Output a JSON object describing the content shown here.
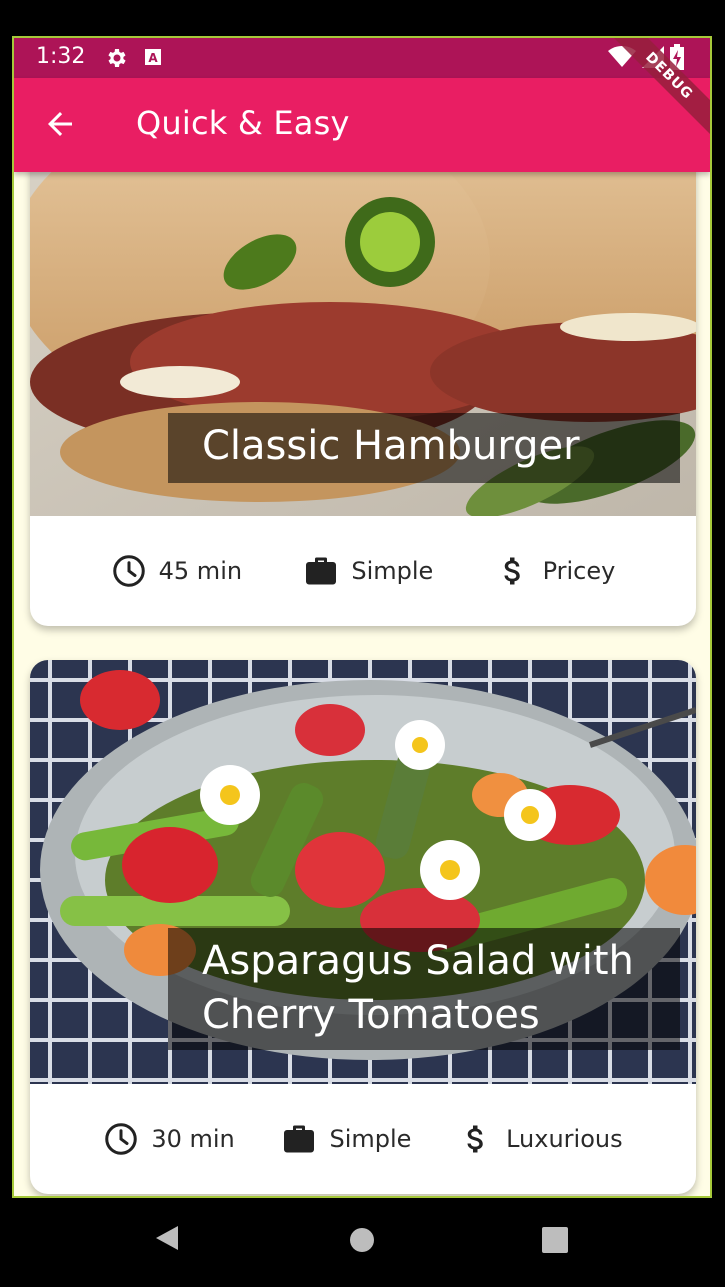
{
  "status_bar": {
    "time": "1:32"
  },
  "app_bar": {
    "title": "Quick & Easy"
  },
  "debug_banner": "DEBUG",
  "meals": [
    {
      "title": "Classic Hamburger",
      "duration": "45 min",
      "complexity": "Simple",
      "affordability": "Pricey"
    },
    {
      "title": "Asparagus Salad with Cherry Tomatoes",
      "duration": "30 min",
      "complexity": "Simple",
      "affordability": "Luxurious"
    }
  ],
  "icons": {
    "back": "arrow-back-icon",
    "duration": "clock-icon",
    "complexity": "briefcase-icon",
    "affordability": "dollar-icon"
  },
  "colors": {
    "status_bar": "#ad1457",
    "app_bar": "#e91e63",
    "background": "#fffde6",
    "frame_border": "#a6c93a"
  }
}
